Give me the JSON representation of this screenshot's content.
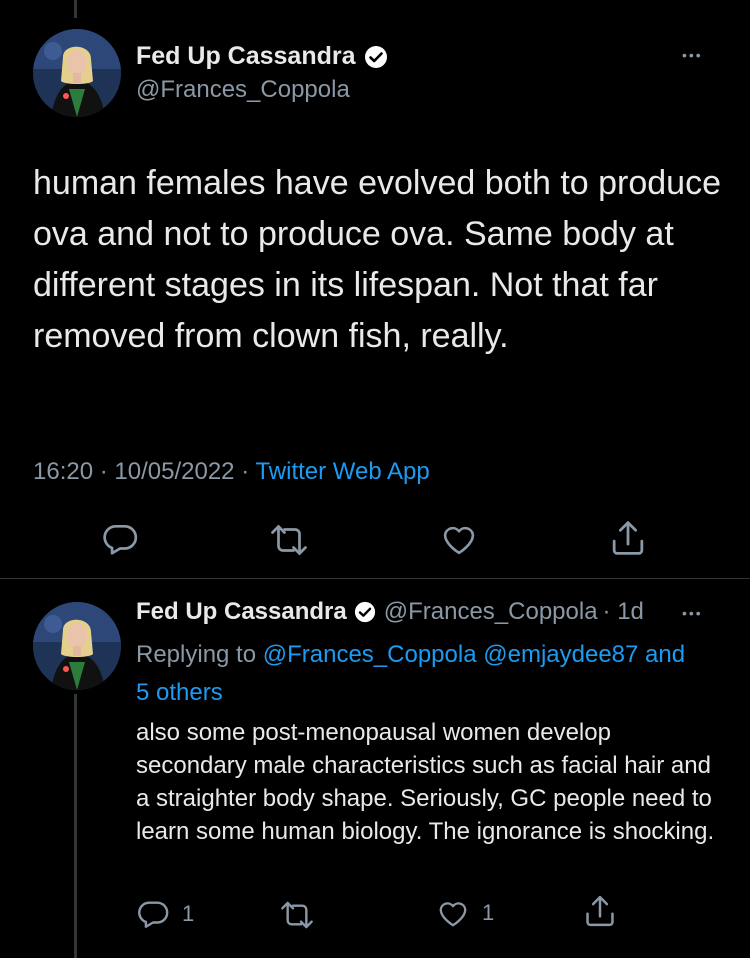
{
  "main_tweet": {
    "display_name": "Fed Up Cassandra",
    "handle": "@Frances_Coppola",
    "text": "human females have evolved both to produce ova and not to produce ova. Same body at different stages in its lifespan. Not that far removed from clown fish, really.",
    "time": "16:20",
    "date": "10/05/2022",
    "source_app": "Twitter Web App",
    "separator": "·",
    "actions": [
      "reply-icon",
      "retweet-icon",
      "like-icon",
      "share-icon"
    ]
  },
  "reply_tweet": {
    "display_name": "Fed Up Cassandra",
    "handle": "@Frances_Coppola",
    "age": "· 1d",
    "replying_prefix": "Replying to",
    "mention_1": "@Frances_Coppola",
    "mention_2": "@emjaydee87",
    "mention_and": "and",
    "mention_others": "5 others",
    "text": "also some post-menopausal women develop secondary male characteristics such as facial hair and a straighter body shape. Seriously, GC people need to learn some human biology. The ignorance is shocking.",
    "reply_count": "1",
    "like_count": "1"
  },
  "more_label": "•••",
  "colors": {
    "background": "#000000",
    "text": "#e7e9ea",
    "secondary": "#8b98a5",
    "link": "#1d9bf0",
    "verified_badge": "#ffffff"
  }
}
